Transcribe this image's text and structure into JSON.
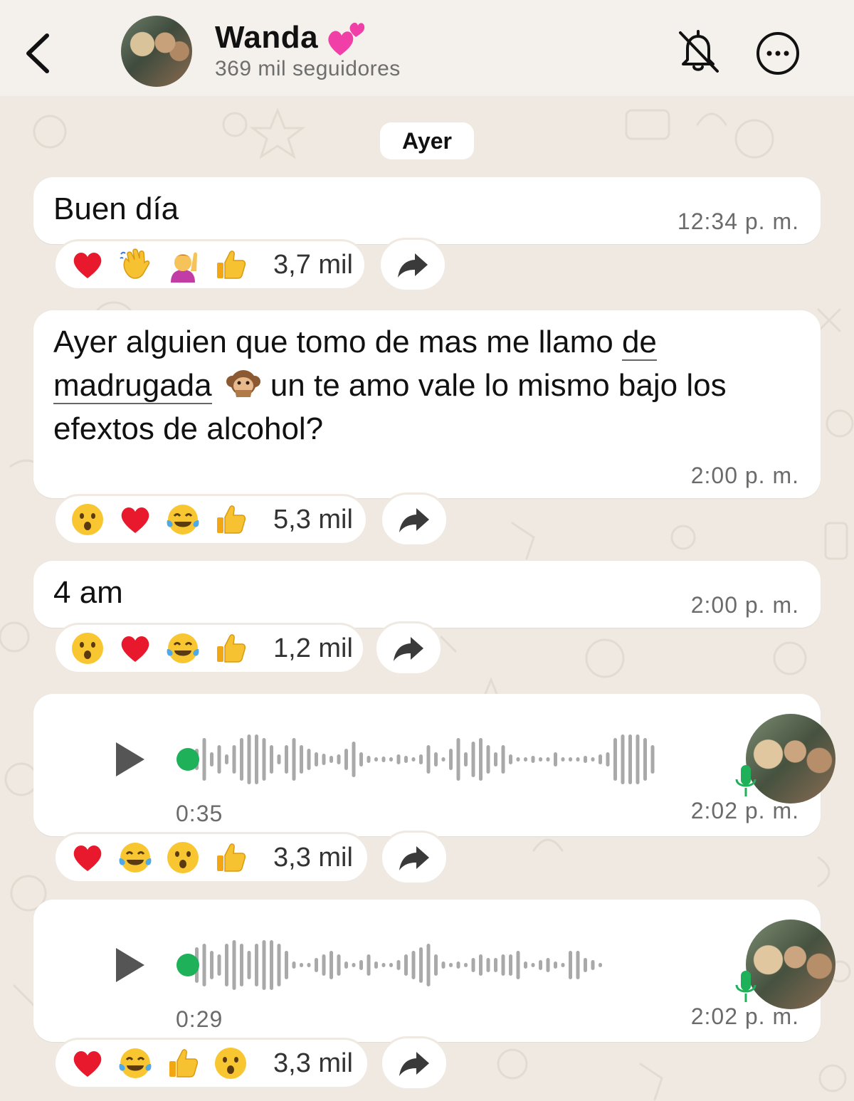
{
  "header": {
    "channel_name": "Wanda",
    "followers": "369 mil seguidores"
  },
  "date_separator": "Ayer",
  "messages": [
    {
      "type": "text",
      "lines": [
        "Buen día"
      ],
      "time": "12:34 p. m.",
      "reactions": [
        "red-heart",
        "waving-hand",
        "person-raising-hand",
        "thumbs-up"
      ],
      "reaction_count": "3,7 mil"
    },
    {
      "type": "text",
      "line1_start": "Ayer alguien que tomo de mas me llamo ",
      "line1_link": "de",
      "line2_link": "madrugada",
      "line2_rest": " un te amo vale lo mismo bajo los",
      "line3": "efextos de alcohol?",
      "emoji": "speak-no-evil-monkey",
      "time": "2:00 p. m.",
      "reactions": [
        "astonished-face",
        "red-heart",
        "tears-of-joy",
        "thumbs-up"
      ],
      "reaction_count": "5,3 mil"
    },
    {
      "type": "text",
      "lines": [
        "4 am"
      ],
      "time": "2:00 p. m.",
      "reactions": [
        "astonished-face",
        "red-heart",
        "tears-of-joy",
        "thumbs-up"
      ],
      "reaction_count": "1,2 mil"
    },
    {
      "type": "voice",
      "duration": "0:35",
      "time": "2:02 p. m.",
      "progress": 0,
      "reactions": [
        "red-heart",
        "tears-of-joy",
        "astonished-face",
        "thumbs-up"
      ],
      "reaction_count": "3,3 mil"
    },
    {
      "type": "voice",
      "duration": "0:29",
      "time": "2:02 p. m.",
      "progress": 0,
      "reactions": [
        "red-heart",
        "tears-of-joy",
        "thumbs-up",
        "astonished-face"
      ],
      "reaction_count": "3,3 mil"
    }
  ],
  "colors": {
    "wallpaper": "#efe9e1",
    "bubble": "#ffffff",
    "voice_accent": "#1fb15a",
    "waveform": "#a9a9a9"
  }
}
